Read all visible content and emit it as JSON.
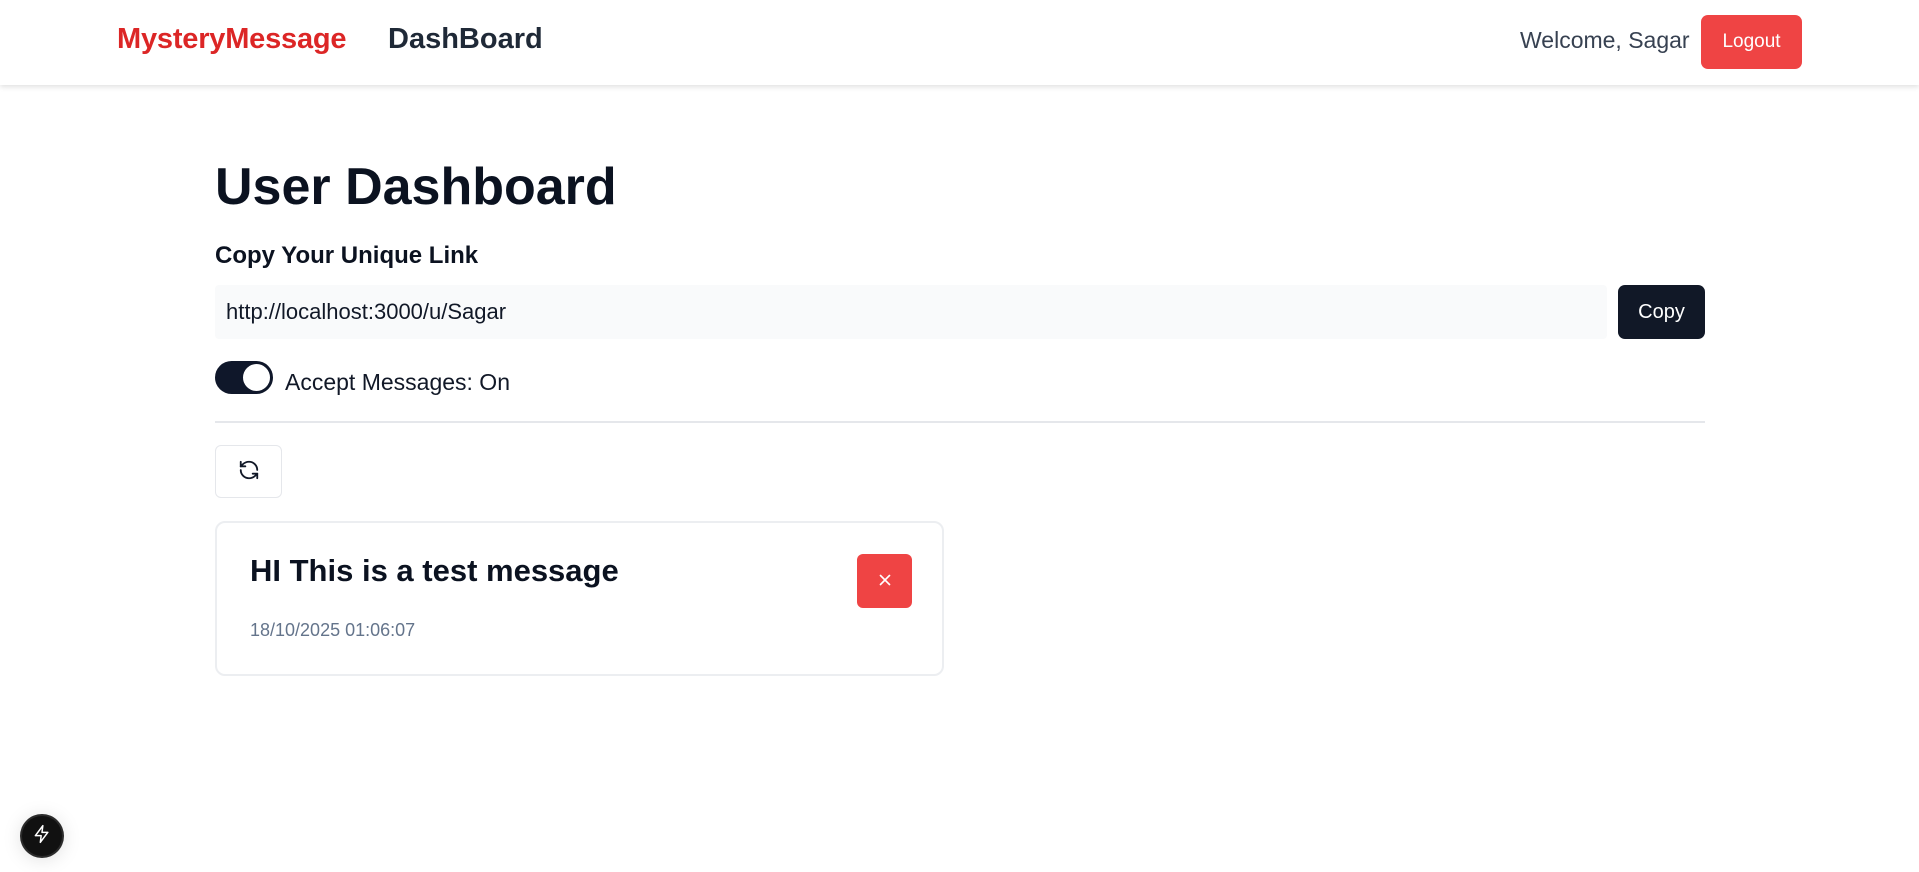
{
  "navbar": {
    "brand": "MysteryMessage",
    "dashboard_link": "DashBoard",
    "welcome_text": "Welcome, Sagar",
    "logout_label": "Logout"
  },
  "main": {
    "title": "User Dashboard",
    "copy_section_label": "Copy Your Unique Link",
    "unique_link_value": "http://localhost:3000/u/Sagar",
    "copy_button_label": "Copy",
    "accept_messages_label": "Accept Messages: On",
    "accept_messages_enabled": true,
    "refresh_icon": "refresh-icon"
  },
  "messages": [
    {
      "content": "HI This is a test message",
      "date": "18/10/2025 01:06:07",
      "delete_icon": "close-icon"
    }
  ],
  "dev_indicator": {
    "icon": "lightning-bolt-icon"
  },
  "colors": {
    "brand": "#dc2626",
    "danger": "#ef4444",
    "primary_dark": "#111827",
    "switch_on": "#0f172a",
    "muted_text": "#64748b"
  }
}
